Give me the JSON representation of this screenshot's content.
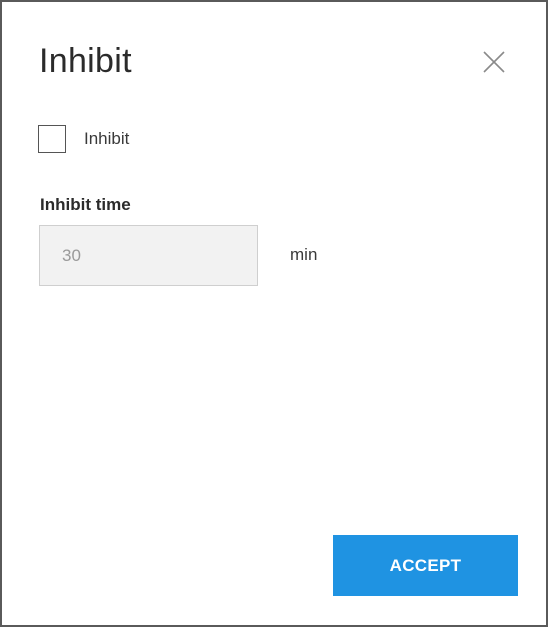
{
  "dialog": {
    "title": "Inhibit",
    "close_icon": "close-icon",
    "inhibit_checkbox": {
      "label": "Inhibit",
      "checked": false
    },
    "inhibit_time": {
      "label": "Inhibit time",
      "value": "30",
      "unit": "min"
    },
    "accept_label": "ACCEPT"
  },
  "colors": {
    "accent": "#1f93e2",
    "input_background": "#f2f2f2",
    "text": "#2b2b2b"
  }
}
